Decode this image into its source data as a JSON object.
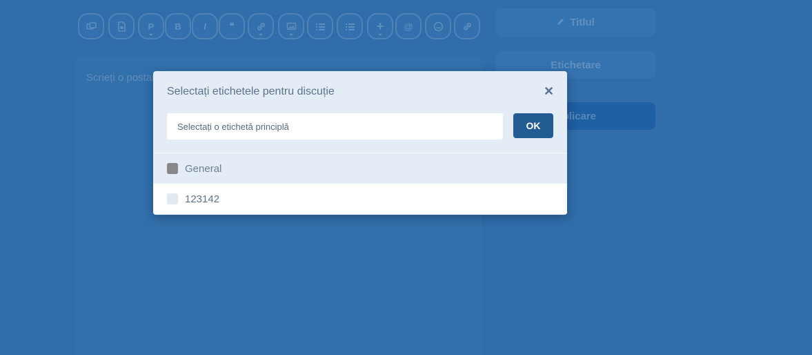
{
  "composer": {
    "toolbar": [
      {
        "icon": "discussion-icon",
        "glyph": "",
        "caret": false
      },
      {
        "icon": "document-icon",
        "glyph": "",
        "caret": false
      },
      {
        "icon": "paragraph-icon",
        "glyph": "P",
        "caret": true
      },
      {
        "icon": "bold-icon",
        "glyph": "B",
        "caret": false
      },
      {
        "icon": "italic-icon",
        "glyph": "I",
        "caret": false
      },
      {
        "icon": "quote-icon",
        "glyph": "❝",
        "caret": false
      },
      {
        "icon": "link-icon",
        "glyph": "",
        "caret": true
      },
      {
        "icon": "image-icon",
        "glyph": "",
        "caret": true
      },
      {
        "icon": "bullet-list-icon",
        "glyph": "",
        "caret": false
      },
      {
        "icon": "numbered-list-icon",
        "glyph": "",
        "caret": false
      },
      {
        "icon": "plus-icon",
        "glyph": "+",
        "caret": true
      },
      {
        "icon": "mention-icon",
        "glyph": "@",
        "caret": false
      },
      {
        "icon": "emoji-icon",
        "glyph": "",
        "caret": false
      },
      {
        "icon": "chain-link-icon",
        "glyph": "",
        "caret": false
      }
    ],
    "editor_placeholder": "Scrieți o postare",
    "title_button": "Titlul",
    "tag_button": "Etichetare",
    "reply_button": "Aplicare"
  },
  "modal": {
    "title": "Selectați etichetele pentru discuție",
    "search_placeholder": "Selectați o etichetă principlă",
    "search_value": "",
    "ok_label": "OK",
    "tags": [
      {
        "label": "General",
        "color": "#888888",
        "selected": true
      },
      {
        "label": "123142",
        "color": "#e1e9f1",
        "selected": false
      }
    ]
  },
  "colors": {
    "background": "#3a78b4",
    "ok_button": "#235b93",
    "modal_background": "#e4ecf5"
  }
}
